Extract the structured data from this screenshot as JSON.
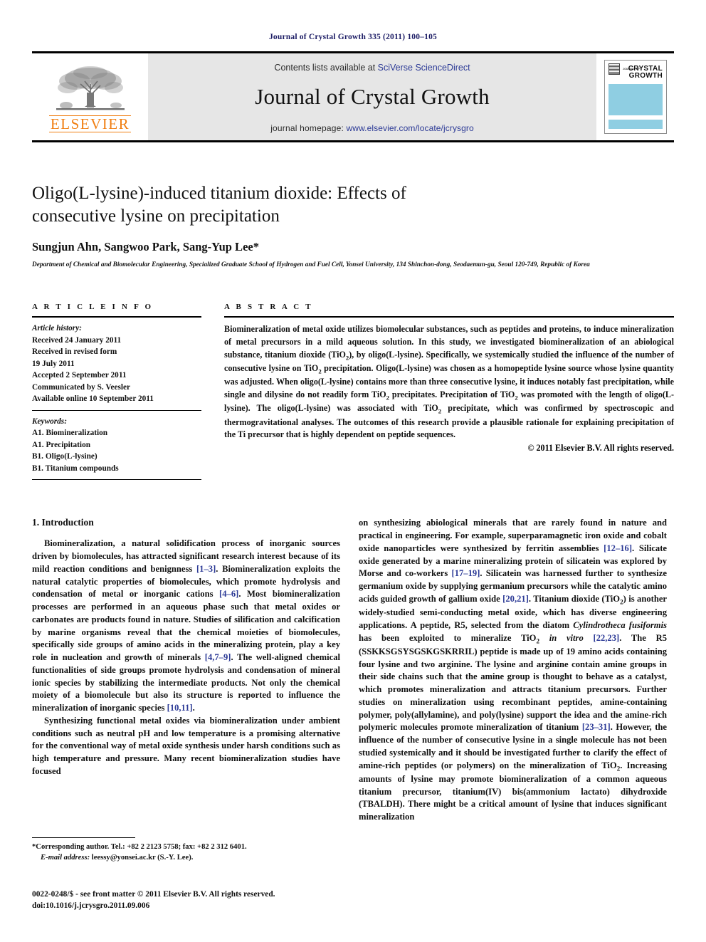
{
  "running_head": "Journal of Crystal Growth 335 (2011) 100–105",
  "masthead": {
    "contents_prefix": "Contents lists available at ",
    "sciencedirect": "SciVerse ScienceDirect",
    "journal_title": "Journal of Crystal Growth",
    "homepage_prefix": "journal homepage: ",
    "homepage_url": "www.elsevier.com/locate/jcrysgro",
    "publisher_logo_text": "ELSEVIER",
    "cover": {
      "journal_of": "JOURNAL OF",
      "line1": "CRYSTAL",
      "line2": "GROWTH",
      "band_color": "#8fcee2"
    }
  },
  "article": {
    "title": "Oligo(L-lysine)-induced titanium dioxide: Effects of consecutive lysine on precipitation",
    "authors": "Sungjun Ahn, Sangwoo Park, Sang-Yup Lee*",
    "affiliation": "Department of Chemical and Biomolecular Engineering, Specialized Graduate School of Hydrogen and Fuel Cell, Yonsei University, 134 Shinchon-dong, Seodaemun-gu, Seoul 120-749, Republic of Korea"
  },
  "article_info": {
    "heading": "A R T I C L E   I N F O",
    "history_label": "Article history:",
    "history": [
      "Received 24 January 2011",
      "Received in revised form",
      "19 July 2011",
      "Accepted 2 September 2011",
      "Communicated by S. Veesler",
      "Available online 10 September 2011"
    ],
    "keywords_label": "Keywords:",
    "keywords": [
      "A1. Biomineralization",
      "A1. Precipitation",
      "B1. Oligo(L-lysine)",
      "B1. Titanium compounds"
    ]
  },
  "abstract": {
    "heading": "A B S T R A C T",
    "paragraph_1": "Biomineralization of metal oxide utilizes biomolecular substances, such as peptides and proteins, to induce mineralization of metal precursors in a mild aqueous solution. In this study, we investigated biomineralization of an abiological substance, titanium dioxide (TiO",
    "paragraph_2": "), by oligo(L-lysine). Specifically, we systemically studied the influence of the number of consecutive lysine on TiO",
    "paragraph_3": " precipitation. Oligo(L-lysine) was chosen as a homopeptide lysine source whose lysine quantity was adjusted. When oligo(L-lysine) contains more than three consecutive lysine, it induces notably fast precipitation, while single and dilysine do not readily form TiO",
    "paragraph_4": " precipitates. Precipitation of TiO",
    "paragraph_5": " was promoted with the length of oligo(L-lysine). The oligo(L-lysine) was associated with TiO",
    "paragraph_6": " precipitate, which was confirmed by spectroscopic and thermogravitational analyses. The outcomes of this research provide a plausible rationale for explaining precipitation of the Ti precursor that is highly dependent on peptide sequences.",
    "copyright": "© 2011 Elsevier B.V. All rights reserved."
  },
  "introduction": {
    "heading": "1.  Introduction",
    "left": {
      "p1_a": "Biomineralization, a natural solidification process of inorganic sources driven by biomolecules, has attracted significant research interest because of its mild reaction conditions and benignness ",
      "p1_ref1": "[1–3]",
      "p1_b": ". Biomineralization exploits the natural catalytic properties of biomolecules, which promote hydrolysis and condensation of metal or inorganic cations ",
      "p1_ref2": "[4–6]",
      "p1_c": ". Most biomineralization processes are performed in an aqueous phase such that metal oxides or carbonates are products found in nature. Studies of silification and calcification by marine organisms reveal that the chemical moieties of biomolecules, specifically side groups of amino acids in the mineralizing protein, play a key role in nucleation and growth of minerals ",
      "p1_ref3": "[4,7–9]",
      "p1_d": ". The well-aligned chemical functionalities of side groups promote hydrolysis and condensation of mineral ionic species by stabilizing the intermediate products. Not only the chemical moiety of a biomolecule but also its structure is reported to influence the mineralization of inorganic species ",
      "p1_ref4": "[10,11]",
      "p1_e": ".",
      "p2": "Synthesizing functional metal oxides via biomineralization under ambient conditions such as neutral pH and low temperature is a promising alternative for the conventional way of metal oxide synthesis under harsh conditions such as high temperature and pressure. Many recent biomineralization studies have focused"
    },
    "right": {
      "a": "on synthesizing abiological minerals that are rarely found in nature and practical in engineering. For example, superparamagnetic iron oxide and cobalt oxide nanoparticles were synthesized by ferritin assemblies ",
      "ref1": "[12–16]",
      "b": ". Silicate oxide generated by a marine mineralizing protein of silicatein was explored by Morse and co-workers ",
      "ref2": "[17–19]",
      "c": ". Silicatein was harnessed further to synthesize germanium oxide by supplying germanium precursors while the catalytic amino acids guided growth of gallium oxide ",
      "ref3": "[20,21]",
      "d": ". Titanium dioxide (TiO",
      "e": ") is another widely-studied semi-conducting metal oxide, which has diverse engineering applications. A peptide, R5, selected from the diatom ",
      "italic1": "Cylindrotheca fusiformis",
      "f": " has been exploited to mineralize TiO",
      "italic2": "in vitro",
      "ref4": "[22,23]",
      "g": ". The R5 (SSKKSGSYSGSKGSKRRIL) peptide is made up of 19 amino acids containing four lysine and two arginine. The lysine and arginine contain amine groups in their side chains such that the amine group is thought to behave as a catalyst, which promotes mineralization and attracts titanium precursors. Further studies on mineralization using recombinant peptides, amine-containing polymer, poly(allylamine), and poly(lysine) support the idea and the amine-rich polymeric molecules promote mineralization of titanium ",
      "ref5": "[23–31]",
      "h": ". However, the influence of the number of consecutive lysine in a single molecule has not been studied systemically and it should be investigated further to clarify the effect of amine-rich peptides (or polymers) on the mineralization of TiO",
      "i": ". Increasing amounts of lysine may promote biomineralization of a common aqueous titanium precursor, titanium(IV) bis(ammonium lactato) dihydroxide (TBALDH). There might be a critical amount of lysine that induces significant mineralization"
    }
  },
  "footer": {
    "corresponding": "Corresponding author. Tel.: +82 2 2123 5758; fax: +82 2 312 6401.",
    "email_label": "E-mail address:",
    "email": " leessy@yonsei.ac.kr (S.-Y. Lee).",
    "issn_line": "0022-0248/$ - see front matter © 2011 Elsevier B.V. All rights reserved.",
    "doi_line": "doi:10.1016/j.jcrysgro.2011.09.006"
  },
  "colors": {
    "link_blue": "#2c3a96",
    "elsevier_orange": "#f07f13",
    "mast_grey": "#e6e6e6",
    "cover_blue": "#8fcee2"
  }
}
